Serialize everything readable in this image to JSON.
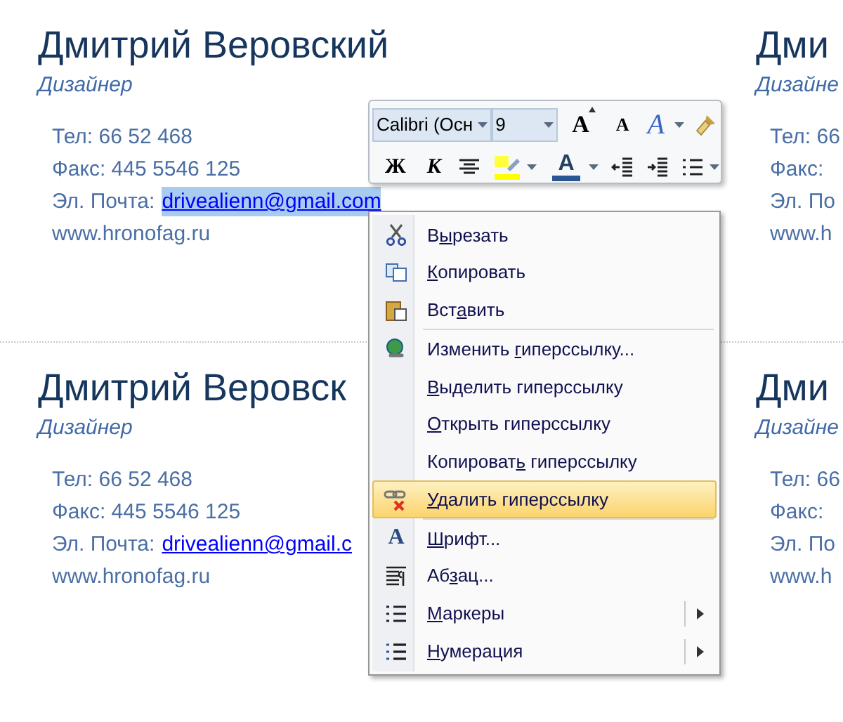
{
  "cards": [
    {
      "name": "Дмитрий Веровский",
      "title": "Дизайнер",
      "lines": [
        {
          "kind": "text",
          "text": "Тел: 66 52 468"
        },
        {
          "kind": "text",
          "text": "Факс:  445 5546 125"
        },
        {
          "kind": "email",
          "label": "Эл. Почта:",
          "link": "drivealienn@gmail.com",
          "selected": true
        },
        {
          "kind": "text",
          "text": "www.hronofag.ru"
        }
      ]
    },
    {
      "name": "Дми",
      "title": "Дизайне",
      "lines": [
        {
          "kind": "text",
          "text": "Тел: 66"
        },
        {
          "kind": "text",
          "text": "Факс:"
        },
        {
          "kind": "text",
          "text": "Эл. По"
        },
        {
          "kind": "text",
          "text": "www.h"
        }
      ]
    },
    {
      "name": "Дмитрий Веровск",
      "title": "Дизайнер",
      "lines": [
        {
          "kind": "text",
          "text": "Тел: 66 52 468"
        },
        {
          "kind": "text",
          "text": "Факс:  445 5546 125"
        },
        {
          "kind": "email",
          "label": "Эл. Почта:",
          "link": "drivealienn@gmail.c",
          "selected": false
        },
        {
          "kind": "text",
          "text": "www.hronofag.ru"
        }
      ]
    },
    {
      "name": "Дми",
      "title": "Дизайне",
      "lines": [
        {
          "kind": "text",
          "text": "Тел: 66"
        },
        {
          "kind": "text",
          "text": "Факс:"
        },
        {
          "kind": "text",
          "text": "Эл. По"
        },
        {
          "kind": "text",
          "text": "www.h"
        }
      ]
    }
  ],
  "mini_toolbar": {
    "font_name": "Calibri (Осн",
    "font_size": "9",
    "row_1": [
      {
        "kind": "grow",
        "label": "A"
      },
      {
        "kind": "shrink",
        "label": "A"
      },
      {
        "kind": "styles",
        "label": "A",
        "dropdown": true
      },
      {
        "kind": "painter"
      }
    ],
    "row_2": [
      {
        "kind": "bold",
        "label": "Ж"
      },
      {
        "kind": "italic",
        "label": "К"
      },
      {
        "kind": "center"
      },
      {
        "kind": "highlight",
        "dropdown": true
      },
      {
        "kind": "fontcolor",
        "label": "A",
        "dropdown": true
      },
      {
        "kind": "outdent"
      },
      {
        "kind": "indent"
      },
      {
        "kind": "bullets",
        "dropdown": true
      }
    ]
  },
  "context_menu": [
    {
      "kind": "item",
      "before": "В",
      "key": "ы",
      "after": "резать",
      "selected": false
    },
    {
      "kind": "item",
      "key": "К",
      "after": "опировать",
      "selected": false
    },
    {
      "kind": "item",
      "before": "Вст",
      "key": "а",
      "after": "вить",
      "selected": false
    },
    {
      "kind": "separator"
    },
    {
      "kind": "item",
      "before": "Изменить ",
      "key": "г",
      "after": "иперссылку...",
      "selected": false
    },
    {
      "kind": "item",
      "key": "В",
      "after": "ыделить гиперссылку",
      "selected": false
    },
    {
      "kind": "item",
      "key": "О",
      "after": "ткрыть гиперссылку",
      "selected": false
    },
    {
      "kind": "item",
      "before": "Копироват",
      "key": "ь",
      "after": " гиперссылку",
      "selected": false
    },
    {
      "kind": "item",
      "key": "У",
      "after": "далить гиперссылку",
      "selected": true
    },
    {
      "kind": "separator"
    },
    {
      "kind": "item",
      "icon_text": "A",
      "key": "Ш",
      "after": "рифт...",
      "selected": false
    },
    {
      "kind": "item",
      "before": "Аб",
      "key": "з",
      "after": "ац...",
      "selected": false
    },
    {
      "kind": "item",
      "key": "М",
      "after": "аркеры",
      "selected": false,
      "submenu": true
    },
    {
      "kind": "item",
      "key": "Н",
      "after": "умерация",
      "selected": false,
      "submenu": true
    }
  ]
}
